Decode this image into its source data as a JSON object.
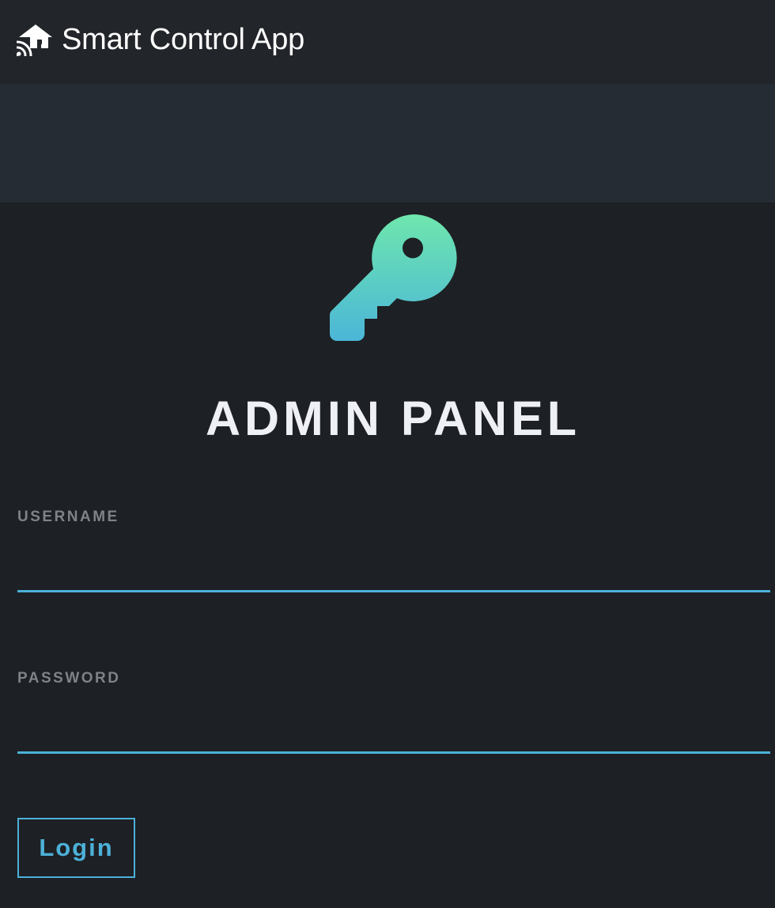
{
  "header": {
    "app_title": "Smart Control App",
    "logo_icon": "smart-home-wifi-icon"
  },
  "main": {
    "hero_icon": "key-icon",
    "title": "ADMIN PANEL"
  },
  "form": {
    "username": {
      "label": "USERNAME",
      "value": ""
    },
    "password": {
      "label": "PASSWORD",
      "value": ""
    },
    "login_label": "Login"
  },
  "colors": {
    "background": "#1d2024",
    "header_background": "#222529",
    "banner_background": "#252c33",
    "accent": "#4cb1d8",
    "key_gradient_top": "#6ee6ad",
    "key_gradient_bottom": "#4cb6d8",
    "label_gray": "#7f8287",
    "title_text": "#eef0f5"
  }
}
